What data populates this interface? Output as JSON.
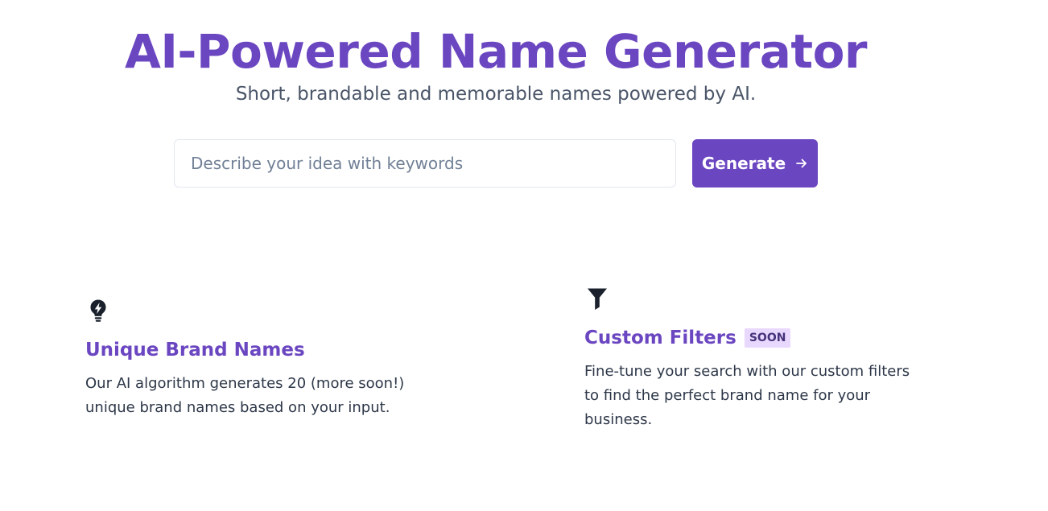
{
  "hero": {
    "title": "AI-Powered Name Generator",
    "subtitle": "Short, brandable and memorable names powered by AI."
  },
  "search": {
    "placeholder": "Describe your idea with keywords",
    "value": ""
  },
  "generate_button": {
    "label": "Generate",
    "icon": "arrow-right-icon"
  },
  "features": [
    {
      "icon": "lightbulb-bolt-icon",
      "title": "Unique Brand Names",
      "description": "Our AI algorithm generates 20 (more soon!) unique brand names based on your input."
    },
    {
      "icon": "funnel-icon",
      "title": "Custom Filters",
      "badge": "SOON",
      "description": "Fine-tune your search with our custom filters to find the perfect brand name for your business."
    }
  ],
  "colors": {
    "accent": "#6b46c1",
    "badge_bg": "#e9d8fd",
    "badge_text": "#44337a",
    "text": "#2d3748",
    "muted": "#4a5568"
  }
}
